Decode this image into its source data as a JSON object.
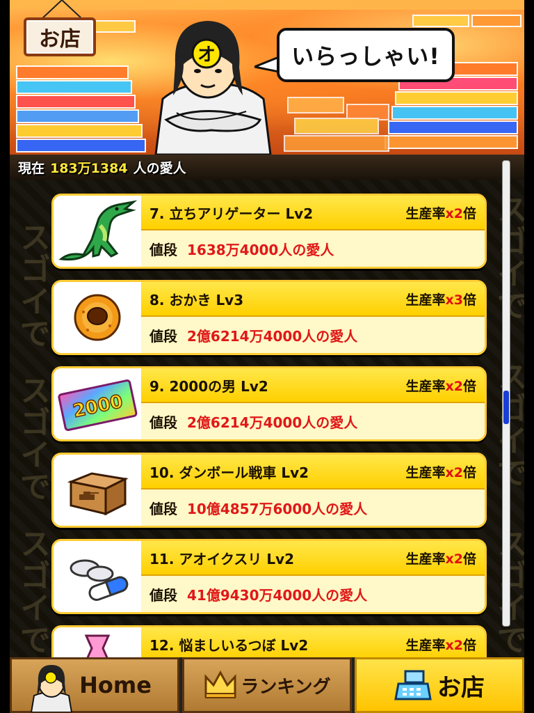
{
  "header": {
    "shop_badge": "お店",
    "shopkeeper_mark": "オ",
    "speech": "いらっしゃい!"
  },
  "status": {
    "prefix": "現在",
    "amount": "183万1384",
    "suffix": "人の愛人"
  },
  "background_text": "スゴイで",
  "items": [
    {
      "name": "7. 立ちアリゲーター Lv2",
      "rate_label": "生産率",
      "rate_mult": "x2",
      "rate_suffix": "倍",
      "price_label": "値段",
      "price": "1638万4000人の愛人",
      "icon": "alligator-icon"
    },
    {
      "name": "8. おかき Lv3",
      "rate_label": "生産率",
      "rate_mult": "x3",
      "rate_suffix": "倍",
      "price_label": "値段",
      "price": "2億6214万4000人の愛人",
      "icon": "donut-icon"
    },
    {
      "name": "9. 2000の男 Lv2",
      "rate_label": "生産率",
      "rate_mult": "x2",
      "rate_suffix": "倍",
      "price_label": "値段",
      "price": "2億6214万4000人の愛人",
      "icon": "ticket-2000-icon",
      "icon_text": "2000"
    },
    {
      "name": "10. ダンボール戦車 Lv2",
      "rate_label": "生産率",
      "rate_mult": "x2",
      "rate_suffix": "倍",
      "price_label": "値段",
      "price": "10億4857万6000人の愛人",
      "icon": "cardboard-box-icon"
    },
    {
      "name": "11. アオイクスリ Lv2",
      "rate_label": "生産率",
      "rate_mult": "x2",
      "rate_suffix": "倍",
      "price_label": "値段",
      "price": "41億9430万4000人の愛人",
      "icon": "pills-icon"
    },
    {
      "name": "12. 悩ましいるつぼ Lv2",
      "rate_label": "生産率",
      "rate_mult": "x2",
      "rate_suffix": "倍",
      "price_label": "値段",
      "price": "",
      "icon": "pink-vase-icon"
    }
  ],
  "nav": {
    "home": "Home",
    "ranking": "ランキング",
    "shop": "お店",
    "home_icon": "shopkeeper-face-icon",
    "ranking_icon": "crown-icon",
    "shop_icon": "cash-register-icon"
  },
  "colors": {
    "accent_yellow": "#ffd000",
    "price_red": "#e01818",
    "amount_yellow": "#ffe83a",
    "scroll_blue": "#1a3fd6"
  }
}
